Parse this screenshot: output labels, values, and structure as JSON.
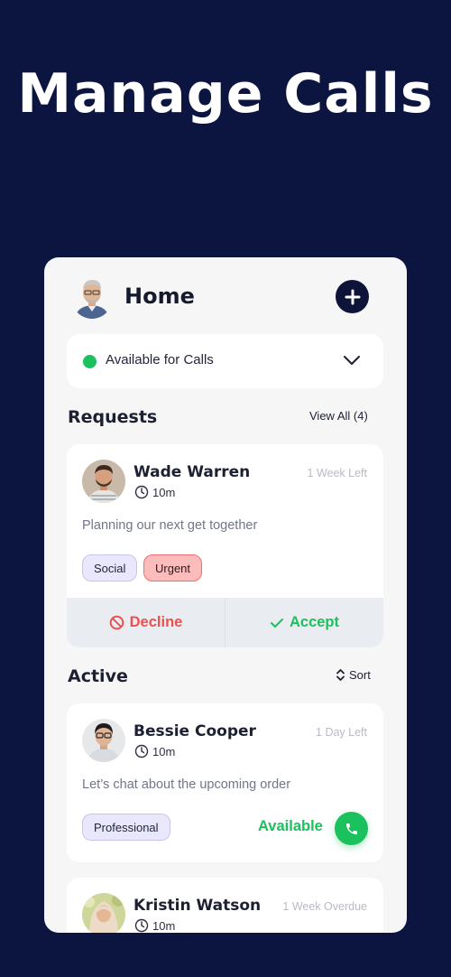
{
  "hero": {
    "title": "Manage Calls"
  },
  "top_bar": {
    "title": "Home",
    "add_icon": "plus-icon"
  },
  "status": {
    "label": "Available for Calls",
    "dot_color": "#1bc15c",
    "icon": "chevron-down-icon"
  },
  "requests": {
    "title": "Requests",
    "view_all_label": "View All (4)",
    "items": [
      {
        "name": "Wade Warren",
        "duration": "10m",
        "time_left": "1 Week Left",
        "message": "Planning our next get together",
        "tags": [
          "Social",
          "Urgent"
        ],
        "decline_label": "Decline",
        "accept_label": "Accept"
      }
    ]
  },
  "active": {
    "title": "Active",
    "sort_label": "Sort",
    "items": [
      {
        "name": "Bessie Cooper",
        "duration": "10m",
        "time_left": "1 Day Left",
        "message": "Let’s chat about the upcoming order",
        "tags": [
          "Professional"
        ],
        "availability": "Available"
      },
      {
        "name": "Kristin Watson",
        "duration": "10m",
        "time_left": "1 Week Overdue"
      }
    ]
  },
  "colors": {
    "background": "#0c1440",
    "accent_green": "#1bc15c",
    "decline_red": "#ef4f4f",
    "card": "#ffffff"
  }
}
